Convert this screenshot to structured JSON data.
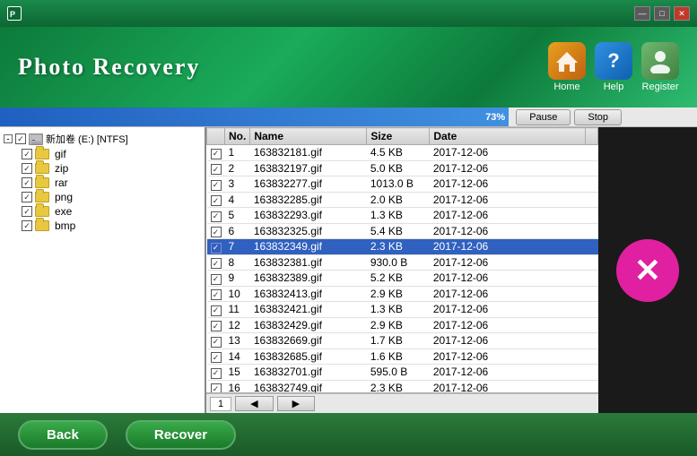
{
  "titleBar": {
    "title": "Photo Recovery",
    "icon": "P",
    "controls": {
      "minimize": "—",
      "restore": "□",
      "close": "✕"
    }
  },
  "header": {
    "title": "Photo  Recovery",
    "nav": [
      {
        "id": "home",
        "label": "Home",
        "icon": "🏠"
      },
      {
        "id": "help",
        "label": "Help",
        "icon": "?"
      },
      {
        "id": "register",
        "label": "Register",
        "icon": "👤"
      }
    ]
  },
  "progress": {
    "percent": "73%",
    "fill_width": "73%",
    "pause_label": "Pause",
    "stop_label": "Stop"
  },
  "fileTree": {
    "root": {
      "label": "新加卷 (E:) [NTFS]",
      "checked": true,
      "expanded": true,
      "children": [
        {
          "label": "gif",
          "checked": true
        },
        {
          "label": "zip",
          "checked": true
        },
        {
          "label": "rar",
          "checked": true
        },
        {
          "label": "png",
          "checked": true
        },
        {
          "label": "exe",
          "checked": true
        },
        {
          "label": "bmp",
          "checked": true
        }
      ]
    }
  },
  "fileTable": {
    "columns": [
      "No.",
      "Name",
      "Size",
      "Date"
    ],
    "rows": [
      {
        "no": 1,
        "name": "163832181.gif",
        "size": "4.5 KB",
        "date": "2017-12-06",
        "checked": true,
        "selected": false
      },
      {
        "no": 2,
        "name": "163832197.gif",
        "size": "5.0 KB",
        "date": "2017-12-06",
        "checked": true,
        "selected": false
      },
      {
        "no": 3,
        "name": "163832277.gif",
        "size": "1013.0 B",
        "date": "2017-12-06",
        "checked": true,
        "selected": false
      },
      {
        "no": 4,
        "name": "163832285.gif",
        "size": "2.0 KB",
        "date": "2017-12-06",
        "checked": true,
        "selected": false
      },
      {
        "no": 5,
        "name": "163832293.gif",
        "size": "1.3 KB",
        "date": "2017-12-06",
        "checked": true,
        "selected": false
      },
      {
        "no": 6,
        "name": "163832325.gif",
        "size": "5.4 KB",
        "date": "2017-12-06",
        "checked": true,
        "selected": false
      },
      {
        "no": 7,
        "name": "163832349.gif",
        "size": "2.3 KB",
        "date": "2017-12-06",
        "checked": true,
        "selected": true
      },
      {
        "no": 8,
        "name": "163832381.gif",
        "size": "930.0 B",
        "date": "2017-12-06",
        "checked": true,
        "selected": false
      },
      {
        "no": 9,
        "name": "163832389.gif",
        "size": "5.2 KB",
        "date": "2017-12-06",
        "checked": true,
        "selected": false
      },
      {
        "no": 10,
        "name": "163832413.gif",
        "size": "2.9 KB",
        "date": "2017-12-06",
        "checked": true,
        "selected": false
      },
      {
        "no": 11,
        "name": "163832421.gif",
        "size": "1.3 KB",
        "date": "2017-12-06",
        "checked": true,
        "selected": false
      },
      {
        "no": 12,
        "name": "163832429.gif",
        "size": "2.9 KB",
        "date": "2017-12-06",
        "checked": true,
        "selected": false
      },
      {
        "no": 13,
        "name": "163832669.gif",
        "size": "1.7 KB",
        "date": "2017-12-06",
        "checked": true,
        "selected": false
      },
      {
        "no": 14,
        "name": "163832685.gif",
        "size": "1.6 KB",
        "date": "2017-12-06",
        "checked": true,
        "selected": false
      },
      {
        "no": 15,
        "name": "163832701.gif",
        "size": "595.0 B",
        "date": "2017-12-06",
        "checked": true,
        "selected": false
      },
      {
        "no": 16,
        "name": "163832749.gif",
        "size": "2.3 KB",
        "date": "2017-12-06",
        "checked": true,
        "selected": false
      }
    ]
  },
  "tableFooter": {
    "page": "1",
    "prev": "◀",
    "next": "▶"
  },
  "bottomBar": {
    "back_label": "Back",
    "recover_label": "Recover"
  }
}
